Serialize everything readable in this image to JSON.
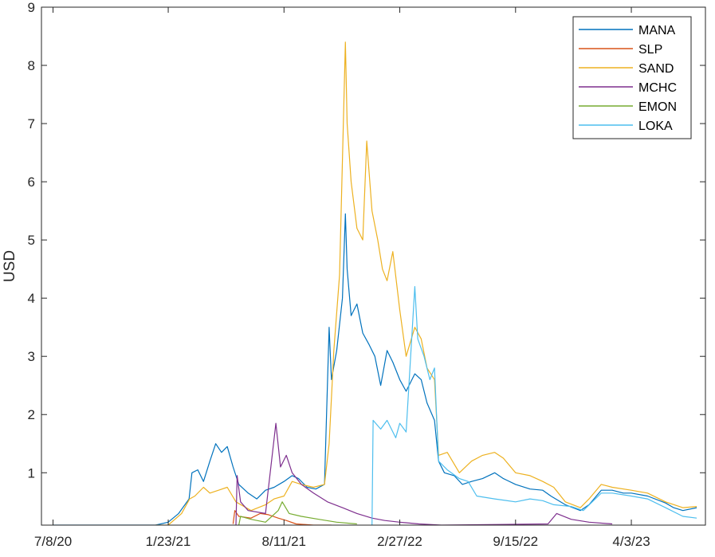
{
  "chart_data": {
    "type": "line",
    "title": "",
    "xlabel": "",
    "ylabel": "USD",
    "x_tick_labels": [
      "7/8/20",
      "1/23/21",
      "8/11/21",
      "2/27/22",
      "9/15/22",
      "4/3/23"
    ],
    "y_tick_labels": [
      "1",
      "2",
      "3",
      "4",
      "5",
      "6",
      "7",
      "8",
      "9"
    ],
    "ylim": [
      0.1,
      9
    ],
    "xlim": [
      "2020-06-18",
      "2023-08-09"
    ],
    "grid": false,
    "legend_position": "top-right",
    "series": [
      {
        "name": "MANA",
        "color": "#0072BD",
        "points": [
          [
            "2020-07-08",
            0.1
          ],
          [
            "2020-08-05",
            0.1
          ],
          [
            "2020-10-28",
            0.09
          ],
          [
            "2020-12-01",
            0.08
          ],
          [
            "2021-01-01",
            0.1
          ],
          [
            "2021-01-23",
            0.15
          ],
          [
            "2021-02-10",
            0.3
          ],
          [
            "2021-02-28",
            0.55
          ],
          [
            "2021-03-05",
            1.0
          ],
          [
            "2021-03-15",
            1.05
          ],
          [
            "2021-03-25",
            0.85
          ],
          [
            "2021-04-05",
            1.2
          ],
          [
            "2021-04-15",
            1.5
          ],
          [
            "2021-04-25",
            1.35
          ],
          [
            "2021-05-05",
            1.45
          ],
          [
            "2021-05-15",
            1.1
          ],
          [
            "2021-05-25",
            0.8
          ],
          [
            "2021-06-10",
            0.65
          ],
          [
            "2021-06-25",
            0.55
          ],
          [
            "2021-07-10",
            0.7
          ],
          [
            "2021-07-25",
            0.75
          ],
          [
            "2021-08-11",
            0.85
          ],
          [
            "2021-08-25",
            0.95
          ],
          [
            "2021-09-05",
            0.9
          ],
          [
            "2021-09-20",
            0.75
          ],
          [
            "2021-10-05",
            0.72
          ],
          [
            "2021-10-20",
            0.8
          ],
          [
            "2021-10-28",
            3.5
          ],
          [
            "2021-11-01",
            2.6
          ],
          [
            "2021-11-10",
            3.1
          ],
          [
            "2021-11-20",
            4.0
          ],
          [
            "2021-11-25",
            5.45
          ],
          [
            "2021-11-28",
            4.5
          ],
          [
            "2021-12-05",
            3.7
          ],
          [
            "2021-12-15",
            3.9
          ],
          [
            "2021-12-25",
            3.4
          ],
          [
            "2022-01-05",
            3.2
          ],
          [
            "2022-01-15",
            3.0
          ],
          [
            "2022-01-25",
            2.5
          ],
          [
            "2022-02-05",
            3.1
          ],
          [
            "2022-02-15",
            2.9
          ],
          [
            "2022-02-27",
            2.6
          ],
          [
            "2022-03-10",
            2.4
          ],
          [
            "2022-03-25",
            2.7
          ],
          [
            "2022-04-05",
            2.6
          ],
          [
            "2022-04-15",
            2.2
          ],
          [
            "2022-04-28",
            1.9
          ],
          [
            "2022-05-05",
            1.2
          ],
          [
            "2022-05-15",
            1.0
          ],
          [
            "2022-06-01",
            0.95
          ],
          [
            "2022-06-15",
            0.8
          ],
          [
            "2022-07-01",
            0.85
          ],
          [
            "2022-07-20",
            0.9
          ],
          [
            "2022-08-10",
            1.0
          ],
          [
            "2022-08-25",
            0.9
          ],
          [
            "2022-09-15",
            0.8
          ],
          [
            "2022-10-10",
            0.72
          ],
          [
            "2022-11-01",
            0.7
          ],
          [
            "2022-11-15",
            0.6
          ],
          [
            "2022-12-10",
            0.45
          ],
          [
            "2023-01-05",
            0.35
          ],
          [
            "2023-01-20",
            0.45
          ],
          [
            "2023-02-10",
            0.7
          ],
          [
            "2023-03-01",
            0.7
          ],
          [
            "2023-03-20",
            0.65
          ],
          [
            "2023-04-03",
            0.65
          ],
          [
            "2023-05-01",
            0.6
          ],
          [
            "2023-06-01",
            0.48
          ],
          [
            "2023-06-15",
            0.4
          ],
          [
            "2023-07-01",
            0.35
          ],
          [
            "2023-07-25",
            0.4
          ]
        ]
      },
      {
        "name": "SLP",
        "color": "#D95319",
        "points": [
          [
            "2021-05-15",
            0.12
          ],
          [
            "2021-05-18",
            0.35
          ],
          [
            "2021-05-25",
            0.25
          ],
          [
            "2021-06-15",
            0.22
          ],
          [
            "2021-07-01",
            0.3
          ],
          [
            "2021-07-15",
            0.28
          ],
          [
            "2021-08-01",
            0.22
          ],
          [
            "2021-08-15",
            0.18
          ],
          [
            "2021-09-01",
            0.12
          ],
          [
            "2021-10-01",
            0.1
          ],
          [
            "2021-11-01",
            0.1
          ]
        ]
      },
      {
        "name": "SAND",
        "color": "#EDB120",
        "points": [
          [
            "2021-01-01",
            0.05
          ],
          [
            "2021-01-23",
            0.1
          ],
          [
            "2021-02-15",
            0.3
          ],
          [
            "2021-03-01",
            0.55
          ],
          [
            "2021-03-10",
            0.6
          ],
          [
            "2021-03-25",
            0.75
          ],
          [
            "2021-04-05",
            0.65
          ],
          [
            "2021-04-20",
            0.7
          ],
          [
            "2021-05-05",
            0.75
          ],
          [
            "2021-05-20",
            0.5
          ],
          [
            "2021-06-15",
            0.35
          ],
          [
            "2021-07-10",
            0.45
          ],
          [
            "2021-07-25",
            0.55
          ],
          [
            "2021-08-11",
            0.6
          ],
          [
            "2021-08-25",
            0.85
          ],
          [
            "2021-09-10",
            0.8
          ],
          [
            "2021-10-01",
            0.75
          ],
          [
            "2021-10-20",
            0.8
          ],
          [
            "2021-10-28",
            1.5
          ],
          [
            "2021-11-05",
            3.1
          ],
          [
            "2021-11-15",
            4.4
          ],
          [
            "2021-11-25",
            8.4
          ],
          [
            "2021-11-28",
            7.0
          ],
          [
            "2021-12-05",
            6.0
          ],
          [
            "2021-12-15",
            5.2
          ],
          [
            "2021-12-25",
            5.0
          ],
          [
            "2022-01-01",
            6.7
          ],
          [
            "2022-01-10",
            5.5
          ],
          [
            "2022-01-20",
            5.0
          ],
          [
            "2022-01-28",
            4.5
          ],
          [
            "2022-02-05",
            4.3
          ],
          [
            "2022-02-15",
            4.8
          ],
          [
            "2022-02-27",
            3.8
          ],
          [
            "2022-03-10",
            3.0
          ],
          [
            "2022-03-25",
            3.5
          ],
          [
            "2022-04-05",
            3.3
          ],
          [
            "2022-04-15",
            2.8
          ],
          [
            "2022-04-28",
            2.6
          ],
          [
            "2022-05-05",
            1.3
          ],
          [
            "2022-05-20",
            1.35
          ],
          [
            "2022-06-10",
            1.0
          ],
          [
            "2022-07-01",
            1.2
          ],
          [
            "2022-07-20",
            1.3
          ],
          [
            "2022-08-10",
            1.35
          ],
          [
            "2022-08-25",
            1.25
          ],
          [
            "2022-09-15",
            1.0
          ],
          [
            "2022-10-10",
            0.95
          ],
          [
            "2022-11-01",
            0.85
          ],
          [
            "2022-11-20",
            0.75
          ],
          [
            "2022-12-10",
            0.5
          ],
          [
            "2023-01-05",
            0.4
          ],
          [
            "2023-01-20",
            0.55
          ],
          [
            "2023-02-10",
            0.8
          ],
          [
            "2023-03-01",
            0.75
          ],
          [
            "2023-04-03",
            0.7
          ],
          [
            "2023-05-01",
            0.65
          ],
          [
            "2023-06-01",
            0.5
          ],
          [
            "2023-07-01",
            0.4
          ],
          [
            "2023-07-25",
            0.42
          ]
        ]
      },
      {
        "name": "MCHC",
        "color": "#7E2F8E",
        "points": [
          [
            "2021-05-20",
            0.1
          ],
          [
            "2021-05-22",
            0.95
          ],
          [
            "2021-05-28",
            0.5
          ],
          [
            "2021-06-10",
            0.35
          ],
          [
            "2021-07-10",
            0.3
          ],
          [
            "2021-07-28",
            1.85
          ],
          [
            "2021-08-05",
            1.1
          ],
          [
            "2021-08-15",
            1.3
          ],
          [
            "2021-08-25",
            1.0
          ],
          [
            "2021-09-10",
            0.8
          ],
          [
            "2021-10-01",
            0.65
          ],
          [
            "2021-10-25",
            0.5
          ],
          [
            "2021-11-20",
            0.4
          ],
          [
            "2021-12-15",
            0.3
          ],
          [
            "2022-01-10",
            0.22
          ],
          [
            "2022-02-01",
            0.18
          ],
          [
            "2022-02-27",
            0.15
          ],
          [
            "2022-04-01",
            0.12
          ],
          [
            "2022-05-10",
            0.1
          ],
          [
            "2022-11-10",
            0.12
          ],
          [
            "2022-11-25",
            0.3
          ],
          [
            "2022-12-20",
            0.2
          ],
          [
            "2023-01-20",
            0.15
          ],
          [
            "2023-03-01",
            0.12
          ]
        ]
      },
      {
        "name": "EMON",
        "color": "#77AC30",
        "points": [
          [
            "2021-05-25",
            0.1
          ],
          [
            "2021-05-28",
            0.25
          ],
          [
            "2021-06-15",
            0.2
          ],
          [
            "2021-07-10",
            0.15
          ],
          [
            "2021-08-01",
            0.35
          ],
          [
            "2021-08-08",
            0.5
          ],
          [
            "2021-08-20",
            0.3
          ],
          [
            "2021-09-10",
            0.25
          ],
          [
            "2021-10-10",
            0.2
          ],
          [
            "2021-11-10",
            0.15
          ],
          [
            "2021-12-15",
            0.12
          ]
        ]
      },
      {
        "name": "LOKA",
        "color": "#4DBEEE",
        "points": [
          [
            "2022-01-10",
            0.1
          ],
          [
            "2022-01-12",
            1.9
          ],
          [
            "2022-01-25",
            1.75
          ],
          [
            "2022-02-05",
            1.9
          ],
          [
            "2022-02-20",
            1.6
          ],
          [
            "2022-02-27",
            1.85
          ],
          [
            "2022-03-10",
            1.7
          ],
          [
            "2022-03-25",
            4.2
          ],
          [
            "2022-03-30",
            3.3
          ],
          [
            "2022-04-10",
            3.0
          ],
          [
            "2022-04-20",
            2.6
          ],
          [
            "2022-04-28",
            2.8
          ],
          [
            "2022-05-05",
            1.2
          ],
          [
            "2022-05-20",
            1.05
          ],
          [
            "2022-06-10",
            0.9
          ],
          [
            "2022-06-25",
            0.85
          ],
          [
            "2022-07-10",
            0.6
          ],
          [
            "2022-08-10",
            0.55
          ],
          [
            "2022-09-15",
            0.5
          ],
          [
            "2022-10-10",
            0.55
          ],
          [
            "2022-11-01",
            0.52
          ],
          [
            "2022-11-20",
            0.45
          ],
          [
            "2022-12-20",
            0.42
          ],
          [
            "2023-01-10",
            0.35
          ],
          [
            "2023-02-10",
            0.65
          ],
          [
            "2023-03-01",
            0.65
          ],
          [
            "2023-04-03",
            0.6
          ],
          [
            "2023-05-01",
            0.55
          ],
          [
            "2023-06-01",
            0.4
          ],
          [
            "2023-07-01",
            0.25
          ],
          [
            "2023-07-25",
            0.22
          ]
        ]
      }
    ]
  }
}
